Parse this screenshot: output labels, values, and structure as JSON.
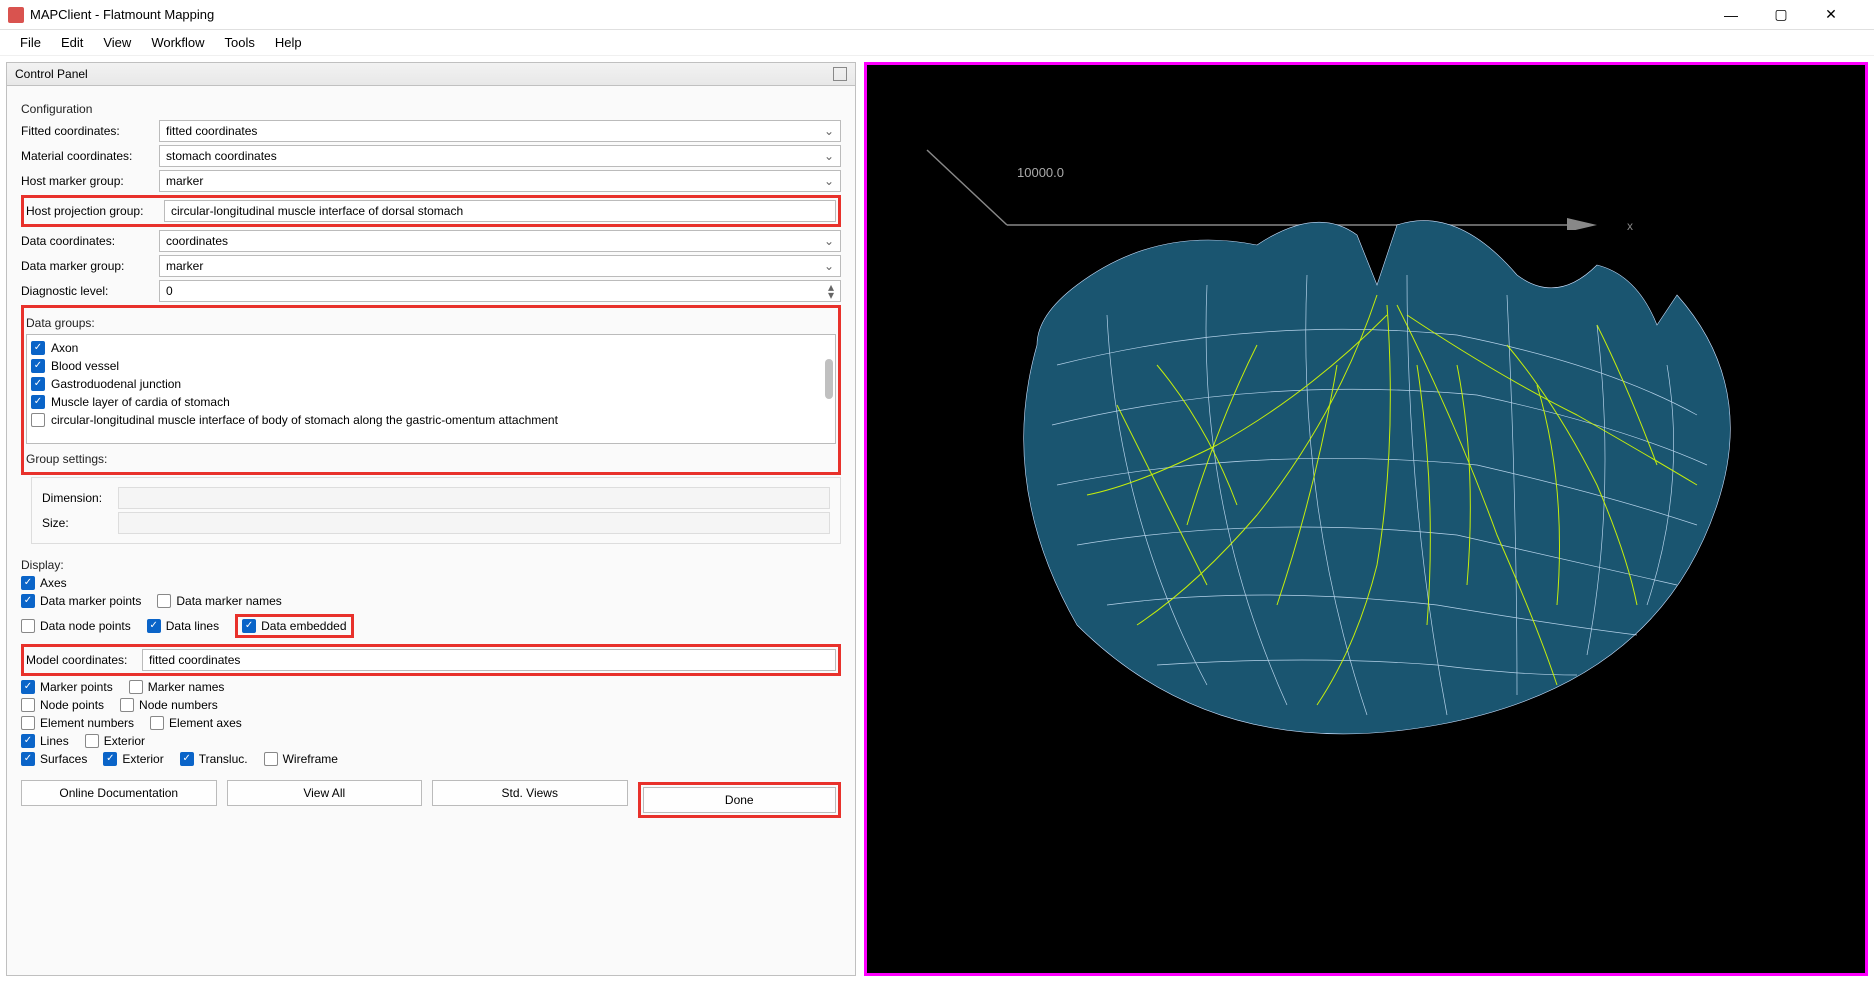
{
  "window": {
    "title": "MAPClient - Flatmount Mapping"
  },
  "menu": [
    "File",
    "Edit",
    "View",
    "Workflow",
    "Tools",
    "Help"
  ],
  "panel": {
    "title": "Control Panel",
    "config_label": "Configuration",
    "rows": {
      "fitted_coords": {
        "label": "Fitted coordinates:",
        "value": "fitted coordinates"
      },
      "material_coords": {
        "label": "Material coordinates:",
        "value": "stomach coordinates"
      },
      "host_marker": {
        "label": "Host marker group:",
        "value": "marker"
      },
      "host_projection": {
        "label": "Host projection group:",
        "value": "circular-longitudinal muscle interface of dorsal stomach"
      },
      "data_coords": {
        "label": "Data coordinates:",
        "value": "coordinates"
      },
      "data_marker": {
        "label": "Data marker group:",
        "value": "marker"
      },
      "diagnostic": {
        "label": "Diagnostic level:",
        "value": "0"
      }
    },
    "data_groups_label": "Data groups:",
    "data_groups": [
      {
        "label": "Axon",
        "checked": true
      },
      {
        "label": "Blood vessel",
        "checked": true
      },
      {
        "label": "Gastroduodenal junction",
        "checked": true
      },
      {
        "label": "Muscle layer of cardia of stomach",
        "checked": true
      },
      {
        "label": "circular-longitudinal muscle interface of body of stomach along the gastric-omentum attachment",
        "checked": false
      }
    ],
    "group_settings_label": "Group settings:",
    "dimension_label": "Dimension:",
    "size_label": "Size:",
    "display_label": "Display:",
    "display": {
      "axes": {
        "label": "Axes",
        "checked": true
      },
      "data_marker_points": {
        "label": "Data marker points",
        "checked": true
      },
      "data_marker_names": {
        "label": "Data marker names",
        "checked": false
      },
      "data_node_points": {
        "label": "Data node points",
        "checked": false
      },
      "data_lines": {
        "label": "Data lines",
        "checked": true
      },
      "data_embedded": {
        "label": "Data embedded",
        "checked": true
      },
      "model_coords": {
        "label": "Model coordinates:",
        "value": "fitted coordinates"
      },
      "marker_points": {
        "label": "Marker points",
        "checked": true
      },
      "marker_names": {
        "label": "Marker names",
        "checked": false
      },
      "node_points": {
        "label": "Node points",
        "checked": false
      },
      "node_numbers": {
        "label": "Node numbers",
        "checked": false
      },
      "element_numbers": {
        "label": "Element numbers",
        "checked": false
      },
      "element_axes": {
        "label": "Element axes",
        "checked": false
      },
      "lines": {
        "label": "Lines",
        "checked": true
      },
      "exterior1": {
        "label": "Exterior",
        "checked": false
      },
      "surfaces": {
        "label": "Surfaces",
        "checked": true
      },
      "exterior2": {
        "label": "Exterior",
        "checked": true
      },
      "transluc": {
        "label": "Transluc.",
        "checked": true
      },
      "wireframe": {
        "label": "Wireframe",
        "checked": false
      }
    },
    "buttons": {
      "docs": "Online Documentation",
      "viewall": "View All",
      "stdviews": "Std. Views",
      "done": "Done"
    }
  },
  "viewport": {
    "axis_value": "10000.0"
  }
}
